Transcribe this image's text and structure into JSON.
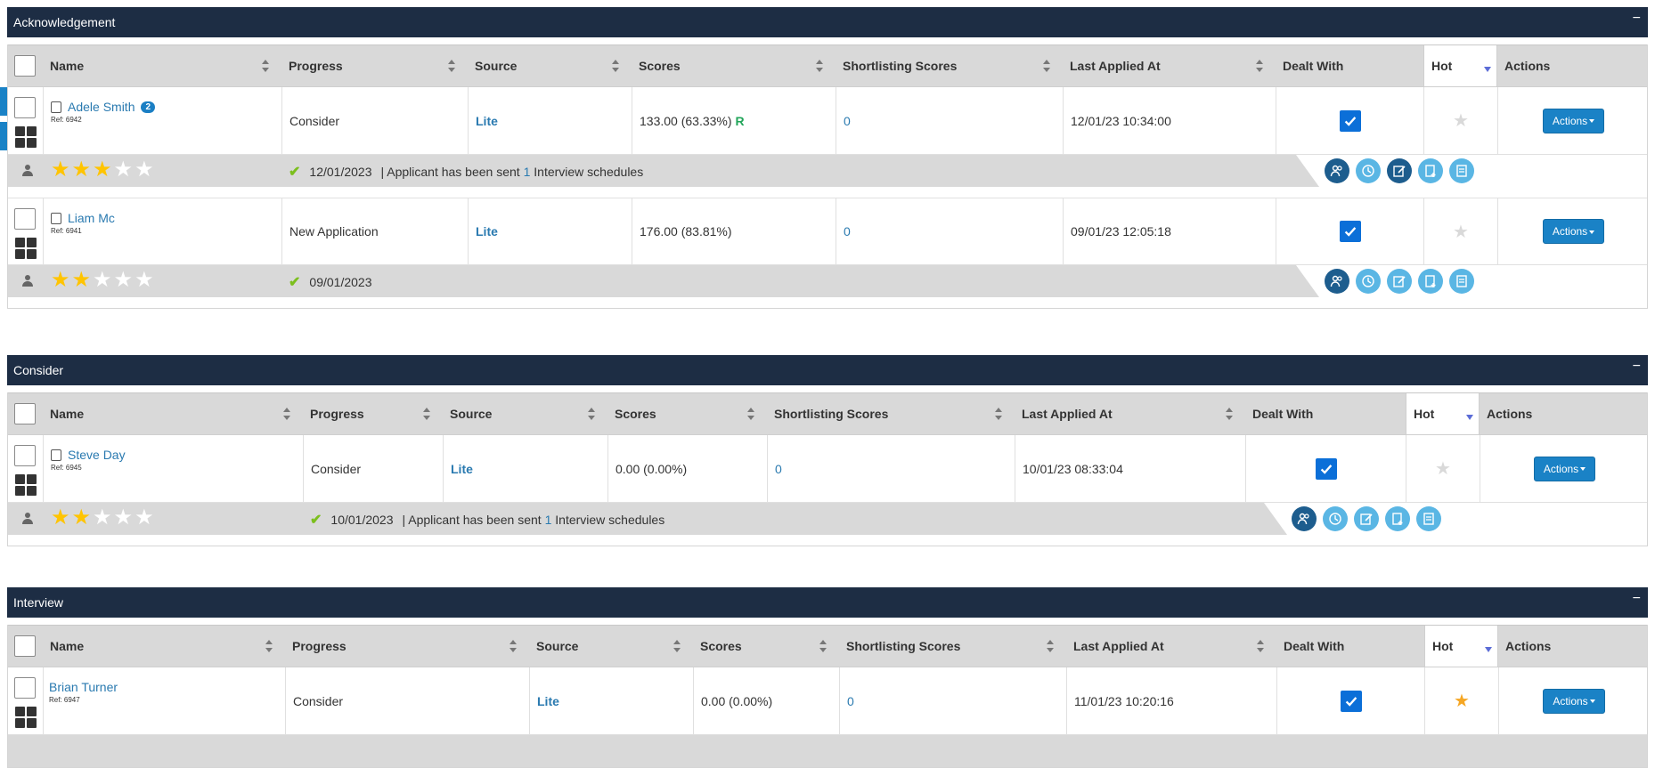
{
  "columns_common": {
    "name": "Name",
    "progress": "Progress",
    "source": "Source",
    "scores": "Scores",
    "shortlisting": "Shortlisting Scores",
    "last_applied": "Last Applied At",
    "dealt_with": "Dealt With",
    "hot": "Hot",
    "actions": "Actions"
  },
  "sections": [
    {
      "title": "Acknowledgement",
      "collapse": "−",
      "rows": [
        {
          "name": "Adele Smith",
          "badge": "2",
          "ref": "Ref: 6942",
          "progress": "Consider",
          "source": "Lite",
          "scores": "133.00 (63.33%)",
          "score_flag": "R",
          "shortlisting": "0",
          "last_applied": "12/01/23 10:34:00",
          "dealt_with": true,
          "hot": false,
          "actions": "Actions",
          "rating": 3,
          "date": "12/01/2023",
          "note_prefix": "| Applicant has been sent",
          "note_count": "1",
          "note_suffix": "Interview schedules"
        },
        {
          "name": "Liam Mc",
          "badge": "",
          "ref": "Ref: 6941",
          "progress": "New Application",
          "source": "Lite",
          "scores": "176.00 (83.81%)",
          "score_flag": "",
          "shortlisting": "0",
          "last_applied": "09/01/23 12:05:18",
          "dealt_with": true,
          "hot": false,
          "actions": "Actions",
          "rating": 2,
          "date": "09/01/2023",
          "note_prefix": "",
          "note_count": "",
          "note_suffix": ""
        }
      ]
    },
    {
      "title": "Consider",
      "collapse": "−",
      "rows": [
        {
          "name": "Steve Day",
          "badge": "",
          "ref": "Ref: 6945",
          "progress": "Consider",
          "source": "Lite",
          "scores": "0.00 (0.00%)",
          "score_flag": "",
          "shortlisting": "0",
          "last_applied": "10/01/23 08:33:04",
          "dealt_with": true,
          "hot": false,
          "actions": "Actions",
          "rating": 2,
          "date": "10/01/2023",
          "note_prefix": "| Applicant has been sent",
          "note_count": "1",
          "note_suffix": "Interview schedules"
        }
      ]
    },
    {
      "title": "Interview",
      "collapse": "−",
      "rows": [
        {
          "name": "Brian Turner",
          "badge": "",
          "ref": "Ref: 6947",
          "progress": "Consider",
          "source": "Lite",
          "scores": "0.00 (0.00%)",
          "score_flag": "",
          "shortlisting": "0",
          "last_applied": "11/01/23 10:20:16",
          "dealt_with": true,
          "hot": true,
          "actions": "Actions"
        }
      ]
    }
  ],
  "colors": {
    "header_bg": "#1d2d44",
    "link": "#2a7ab0",
    "button": "#1a82c6",
    "star": "#ffc400",
    "hot_star": "#f5a623"
  },
  "icons": [
    "person-icon",
    "grid-icon",
    "document-icon",
    "checkmark-icon",
    "star-icon",
    "users-icon",
    "clock-icon",
    "edit-icon",
    "add-note-icon",
    "review-icon"
  ]
}
